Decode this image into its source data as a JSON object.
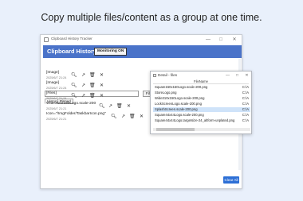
{
  "headline": "Copy multiple files/content as a group at one time.",
  "main_window": {
    "title": "Clipboard History Tracker",
    "controls": [
      "—",
      "□",
      "✕"
    ],
    "app_title": "Clipboard History",
    "monitoring_label": "Monitoring ON",
    "filter_label": "Filter",
    "reset_label": "Reset",
    "tabs": [
      "History",
      "Pinned"
    ],
    "items": [
      {
        "text": "[Image]",
        "date": "2025/6/7 21:24"
      },
      {
        "text": "[Image]",
        "date": "2025/6/7 21:24"
      },
      {
        "text": "[Files]",
        "date": "2025/6/7 21:24"
      },
      {
        "text": "Wide310x150Logo.scale-200",
        "date": "2025/6/7 21:21"
      },
      {
        "text": "Icon=\"/ImgFolder/TaskbarIcon.png\"",
        "date": "2025/6/7 21:21"
      }
    ],
    "clear_all_label": "Clear All"
  },
  "detail_window": {
    "title": "Detail - files",
    "controls": [
      "—",
      "□",
      "✕"
    ],
    "column_header": "FileName",
    "files": [
      {
        "name": "Square150x150Logo.scale-200.png",
        "type": "C:\\A"
      },
      {
        "name": "StoreLogo.png",
        "type": "C:\\A"
      },
      {
        "name": "Wide310x150Logo.scale-200.png",
        "type": "C:\\A"
      },
      {
        "name": "LockScreenLogo.scale-200.png",
        "type": "C:\\A"
      },
      {
        "name": "SplashScreen.scale-200.png",
        "type": "C:\\A",
        "selected": true
      },
      {
        "name": "Square44x44Logo.scale-200.png",
        "type": "C:\\A"
      },
      {
        "name": "Square44x44Logo.targetsize-24_altform-unplated.png",
        "type": "C:\\A"
      }
    ]
  }
}
